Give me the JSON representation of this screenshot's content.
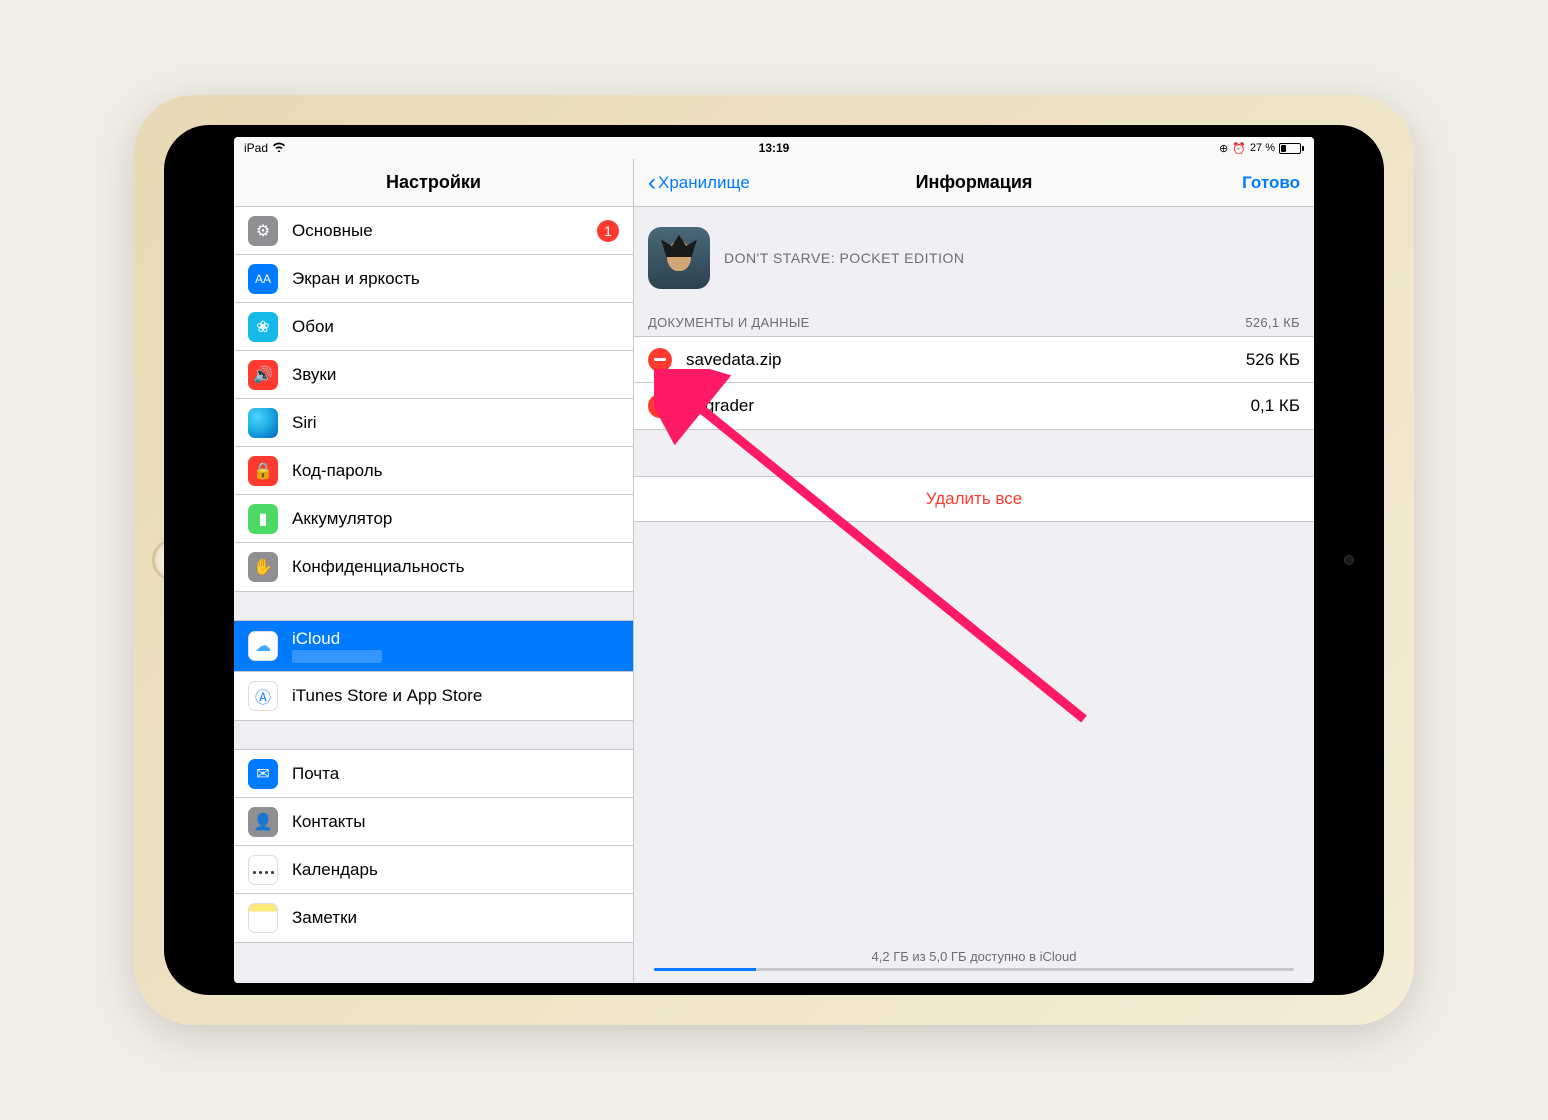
{
  "statusBar": {
    "device": "iPad",
    "time": "13:19",
    "battery": "27 %"
  },
  "sidebar": {
    "title": "Настройки",
    "groups": [
      {
        "items": [
          {
            "label": "Основные",
            "badge": "1",
            "iconColor": "ic-gray",
            "glyph": "⚙"
          },
          {
            "label": "Экран и яркость",
            "iconColor": "ic-blue",
            "glyph": "AA"
          },
          {
            "label": "Обои",
            "iconColor": "ic-cyan",
            "glyph": "❀"
          },
          {
            "label": "Звуки",
            "iconColor": "ic-red",
            "glyph": "🔊"
          },
          {
            "label": "Siri",
            "iconColor": "siri-orb",
            "glyph": ""
          },
          {
            "label": "Код-пароль",
            "iconColor": "ic-red",
            "glyph": "🔒"
          },
          {
            "label": "Аккумулятор",
            "iconColor": "ic-green",
            "glyph": "▮"
          },
          {
            "label": "Конфиденциальность",
            "iconColor": "ic-gray2",
            "glyph": "✋"
          }
        ]
      },
      {
        "items": [
          {
            "label": "iCloud",
            "sub": "",
            "selected": true,
            "iconColor": "ic-white",
            "glyph": "☁",
            "glyphColor": "#3ea9ff"
          },
          {
            "label": "iTunes Store и App Store",
            "iconColor": "ic-white",
            "glyph": "Ⓐ",
            "glyphColor": "#1e88ff"
          }
        ]
      },
      {
        "items": [
          {
            "label": "Почта",
            "iconColor": "ic-blue",
            "glyph": "✉"
          },
          {
            "label": "Контакты",
            "iconColor": "ic-gray2",
            "glyph": "👤"
          },
          {
            "label": "Календарь",
            "iconColor": "cal-icon",
            "glyph": ""
          },
          {
            "label": "Заметки",
            "iconColor": "notes-icon",
            "glyph": ""
          }
        ]
      }
    ]
  },
  "main": {
    "back": "Хранилище",
    "title": "Информация",
    "done": "Готово",
    "appName": "DON'T STARVE: POCKET EDITION",
    "sectionTitle": "ДОКУМЕНТЫ И ДАННЫЕ",
    "sectionSize": "526,1 КБ",
    "docs": [
      {
        "name": "savedata.zip",
        "size": "526 КБ"
      },
      {
        "name": "upgrader",
        "size": "0,1 КБ"
      }
    ],
    "deleteAll": "Удалить все",
    "footer": "4,2 ГБ из 5,0 ГБ доступно в iCloud"
  }
}
